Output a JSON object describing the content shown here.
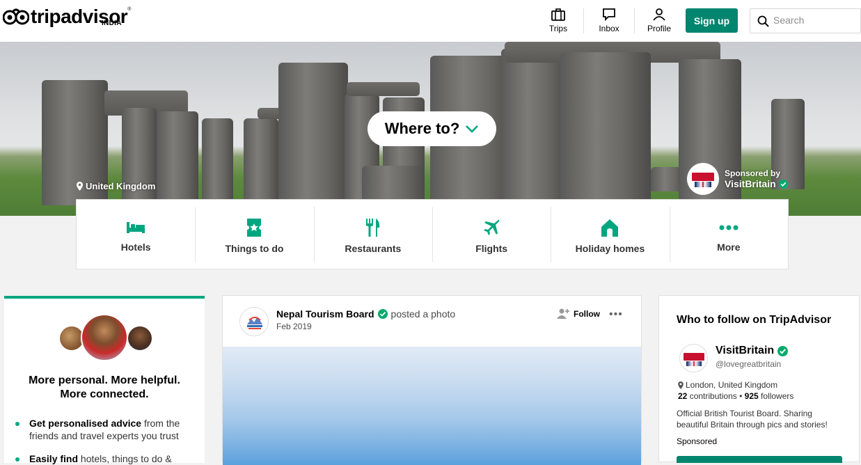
{
  "header": {
    "logo_text": "tripadvisor",
    "logo_sub": "INDIA",
    "nav": [
      {
        "label": "Trips",
        "icon": "suitcase-icon"
      },
      {
        "label": "Inbox",
        "icon": "chat-icon"
      },
      {
        "label": "Profile",
        "icon": "person-icon"
      }
    ],
    "signup_label": "Sign up",
    "search_placeholder": "Search"
  },
  "hero": {
    "where_label": "Where to?",
    "location": "United Kingdom",
    "sponsored_by": "Sponsored by",
    "sponsor_name": "VisitBritain"
  },
  "categories": [
    {
      "label": "Hotels",
      "icon": "bed-icon"
    },
    {
      "label": "Things to do",
      "icon": "ticket-icon"
    },
    {
      "label": "Restaurants",
      "icon": "cutlery-icon"
    },
    {
      "label": "Flights",
      "icon": "plane-icon"
    },
    {
      "label": "Holiday homes",
      "icon": "house-icon"
    },
    {
      "label": "More",
      "icon": "dots-icon"
    }
  ],
  "left_card": {
    "title_line1": "More personal. More helpful.",
    "title_line2": "More connected.",
    "bullet1_bold": "Get personalised advice",
    "bullet1_rest": " from the friends and travel experts you trust",
    "bullet2_bold": "Easily find",
    "bullet2_rest": " hotels, things to do &"
  },
  "post": {
    "author": "Nepal Tourism Board",
    "action": "posted a photo",
    "date": "Feb 2019",
    "follow_label": "Follow",
    "more": "•••"
  },
  "right_card": {
    "title": "Who to follow on TripAdvisor",
    "name": "VisitBritain",
    "handle": "@lovegreatbritain",
    "location": "London, United Kingdom",
    "contributions": "22",
    "contributions_label": "contributions",
    "followers": "925",
    "followers_label": "followers",
    "description": "Official British Tourist Board. Sharing beautiful Britain through pics and stories!",
    "sponsored": "Sponsored"
  },
  "colors": {
    "brand_green": "#00a680",
    "button_green": "#00856f",
    "verified": "#00aa6c"
  }
}
